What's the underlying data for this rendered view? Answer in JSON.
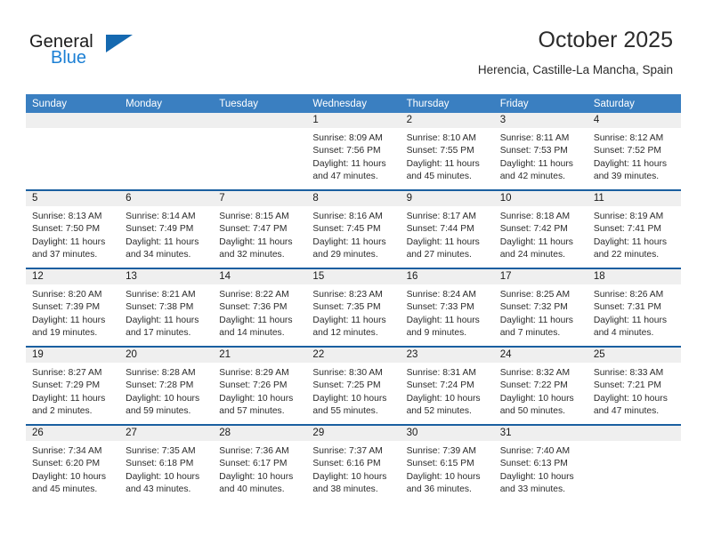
{
  "brand": {
    "word_one": "General",
    "word_two": "Blue",
    "triangle_icon": "triangle-logo-icon"
  },
  "header": {
    "title": "October 2025",
    "subtitle": "Herencia, Castille-La Mancha, Spain"
  },
  "colors": {
    "header_blue": "#3a7fc1",
    "row_divider": "#1a5fa0",
    "daynum_strip": "#efefef",
    "brand_blue": "#1b7fd4",
    "text": "#2b2b2b"
  },
  "weekday_headers": [
    "Sunday",
    "Monday",
    "Tuesday",
    "Wednesday",
    "Thursday",
    "Friday",
    "Saturday"
  ],
  "weeks": [
    [
      {
        "day": "",
        "sunrise": "",
        "sunset": "",
        "daylight_line1": "",
        "daylight_line2": ""
      },
      {
        "day": "",
        "sunrise": "",
        "sunset": "",
        "daylight_line1": "",
        "daylight_line2": ""
      },
      {
        "day": "",
        "sunrise": "",
        "sunset": "",
        "daylight_line1": "",
        "daylight_line2": ""
      },
      {
        "day": "1",
        "sunrise": "Sunrise: 8:09 AM",
        "sunset": "Sunset: 7:56 PM",
        "daylight_line1": "Daylight: 11 hours",
        "daylight_line2": "and 47 minutes."
      },
      {
        "day": "2",
        "sunrise": "Sunrise: 8:10 AM",
        "sunset": "Sunset: 7:55 PM",
        "daylight_line1": "Daylight: 11 hours",
        "daylight_line2": "and 45 minutes."
      },
      {
        "day": "3",
        "sunrise": "Sunrise: 8:11 AM",
        "sunset": "Sunset: 7:53 PM",
        "daylight_line1": "Daylight: 11 hours",
        "daylight_line2": "and 42 minutes."
      },
      {
        "day": "4",
        "sunrise": "Sunrise: 8:12 AM",
        "sunset": "Sunset: 7:52 PM",
        "daylight_line1": "Daylight: 11 hours",
        "daylight_line2": "and 39 minutes."
      }
    ],
    [
      {
        "day": "5",
        "sunrise": "Sunrise: 8:13 AM",
        "sunset": "Sunset: 7:50 PM",
        "daylight_line1": "Daylight: 11 hours",
        "daylight_line2": "and 37 minutes."
      },
      {
        "day": "6",
        "sunrise": "Sunrise: 8:14 AM",
        "sunset": "Sunset: 7:49 PM",
        "daylight_line1": "Daylight: 11 hours",
        "daylight_line2": "and 34 minutes."
      },
      {
        "day": "7",
        "sunrise": "Sunrise: 8:15 AM",
        "sunset": "Sunset: 7:47 PM",
        "daylight_line1": "Daylight: 11 hours",
        "daylight_line2": "and 32 minutes."
      },
      {
        "day": "8",
        "sunrise": "Sunrise: 8:16 AM",
        "sunset": "Sunset: 7:45 PM",
        "daylight_line1": "Daylight: 11 hours",
        "daylight_line2": "and 29 minutes."
      },
      {
        "day": "9",
        "sunrise": "Sunrise: 8:17 AM",
        "sunset": "Sunset: 7:44 PM",
        "daylight_line1": "Daylight: 11 hours",
        "daylight_line2": "and 27 minutes."
      },
      {
        "day": "10",
        "sunrise": "Sunrise: 8:18 AM",
        "sunset": "Sunset: 7:42 PM",
        "daylight_line1": "Daylight: 11 hours",
        "daylight_line2": "and 24 minutes."
      },
      {
        "day": "11",
        "sunrise": "Sunrise: 8:19 AM",
        "sunset": "Sunset: 7:41 PM",
        "daylight_line1": "Daylight: 11 hours",
        "daylight_line2": "and 22 minutes."
      }
    ],
    [
      {
        "day": "12",
        "sunrise": "Sunrise: 8:20 AM",
        "sunset": "Sunset: 7:39 PM",
        "daylight_line1": "Daylight: 11 hours",
        "daylight_line2": "and 19 minutes."
      },
      {
        "day": "13",
        "sunrise": "Sunrise: 8:21 AM",
        "sunset": "Sunset: 7:38 PM",
        "daylight_line1": "Daylight: 11 hours",
        "daylight_line2": "and 17 minutes."
      },
      {
        "day": "14",
        "sunrise": "Sunrise: 8:22 AM",
        "sunset": "Sunset: 7:36 PM",
        "daylight_line1": "Daylight: 11 hours",
        "daylight_line2": "and 14 minutes."
      },
      {
        "day": "15",
        "sunrise": "Sunrise: 8:23 AM",
        "sunset": "Sunset: 7:35 PM",
        "daylight_line1": "Daylight: 11 hours",
        "daylight_line2": "and 12 minutes."
      },
      {
        "day": "16",
        "sunrise": "Sunrise: 8:24 AM",
        "sunset": "Sunset: 7:33 PM",
        "daylight_line1": "Daylight: 11 hours",
        "daylight_line2": "and 9 minutes."
      },
      {
        "day": "17",
        "sunrise": "Sunrise: 8:25 AM",
        "sunset": "Sunset: 7:32 PM",
        "daylight_line1": "Daylight: 11 hours",
        "daylight_line2": "and 7 minutes."
      },
      {
        "day": "18",
        "sunrise": "Sunrise: 8:26 AM",
        "sunset": "Sunset: 7:31 PM",
        "daylight_line1": "Daylight: 11 hours",
        "daylight_line2": "and 4 minutes."
      }
    ],
    [
      {
        "day": "19",
        "sunrise": "Sunrise: 8:27 AM",
        "sunset": "Sunset: 7:29 PM",
        "daylight_line1": "Daylight: 11 hours",
        "daylight_line2": "and 2 minutes."
      },
      {
        "day": "20",
        "sunrise": "Sunrise: 8:28 AM",
        "sunset": "Sunset: 7:28 PM",
        "daylight_line1": "Daylight: 10 hours",
        "daylight_line2": "and 59 minutes."
      },
      {
        "day": "21",
        "sunrise": "Sunrise: 8:29 AM",
        "sunset": "Sunset: 7:26 PM",
        "daylight_line1": "Daylight: 10 hours",
        "daylight_line2": "and 57 minutes."
      },
      {
        "day": "22",
        "sunrise": "Sunrise: 8:30 AM",
        "sunset": "Sunset: 7:25 PM",
        "daylight_line1": "Daylight: 10 hours",
        "daylight_line2": "and 55 minutes."
      },
      {
        "day": "23",
        "sunrise": "Sunrise: 8:31 AM",
        "sunset": "Sunset: 7:24 PM",
        "daylight_line1": "Daylight: 10 hours",
        "daylight_line2": "and 52 minutes."
      },
      {
        "day": "24",
        "sunrise": "Sunrise: 8:32 AM",
        "sunset": "Sunset: 7:22 PM",
        "daylight_line1": "Daylight: 10 hours",
        "daylight_line2": "and 50 minutes."
      },
      {
        "day": "25",
        "sunrise": "Sunrise: 8:33 AM",
        "sunset": "Sunset: 7:21 PM",
        "daylight_line1": "Daylight: 10 hours",
        "daylight_line2": "and 47 minutes."
      }
    ],
    [
      {
        "day": "26",
        "sunrise": "Sunrise: 7:34 AM",
        "sunset": "Sunset: 6:20 PM",
        "daylight_line1": "Daylight: 10 hours",
        "daylight_line2": "and 45 minutes."
      },
      {
        "day": "27",
        "sunrise": "Sunrise: 7:35 AM",
        "sunset": "Sunset: 6:18 PM",
        "daylight_line1": "Daylight: 10 hours",
        "daylight_line2": "and 43 minutes."
      },
      {
        "day": "28",
        "sunrise": "Sunrise: 7:36 AM",
        "sunset": "Sunset: 6:17 PM",
        "daylight_line1": "Daylight: 10 hours",
        "daylight_line2": "and 40 minutes."
      },
      {
        "day": "29",
        "sunrise": "Sunrise: 7:37 AM",
        "sunset": "Sunset: 6:16 PM",
        "daylight_line1": "Daylight: 10 hours",
        "daylight_line2": "and 38 minutes."
      },
      {
        "day": "30",
        "sunrise": "Sunrise: 7:39 AM",
        "sunset": "Sunset: 6:15 PM",
        "daylight_line1": "Daylight: 10 hours",
        "daylight_line2": "and 36 minutes."
      },
      {
        "day": "31",
        "sunrise": "Sunrise: 7:40 AM",
        "sunset": "Sunset: 6:13 PM",
        "daylight_line1": "Daylight: 10 hours",
        "daylight_line2": "and 33 minutes."
      },
      {
        "day": "",
        "sunrise": "",
        "sunset": "",
        "daylight_line1": "",
        "daylight_line2": ""
      }
    ]
  ]
}
